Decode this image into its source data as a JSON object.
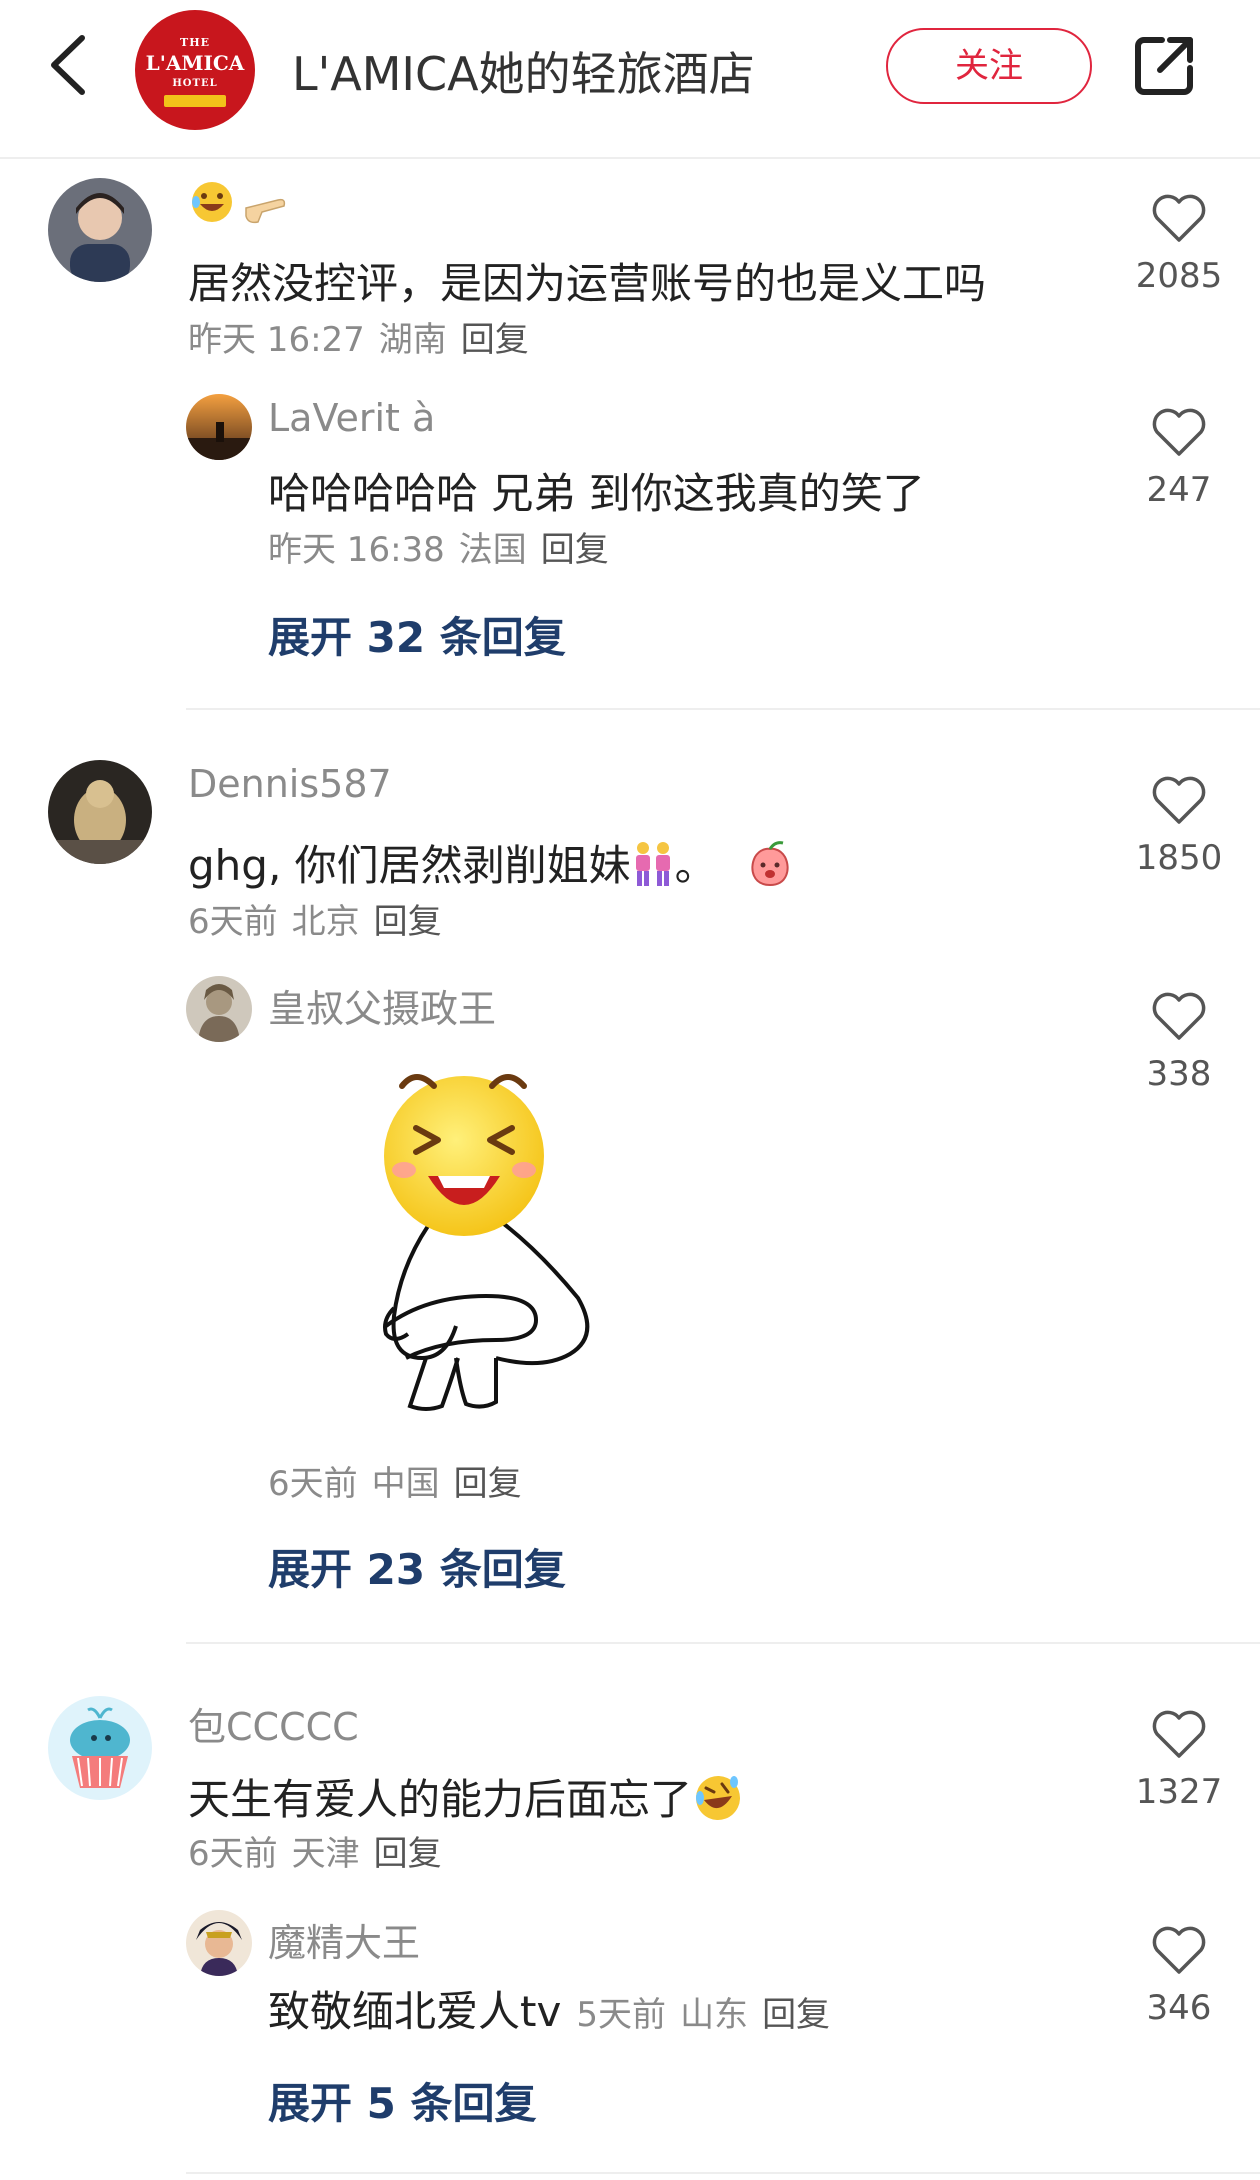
{
  "header": {
    "logo_text": {
      "line1": "THE",
      "line2": "L'AMICA",
      "line3": "HOTEL"
    },
    "title": "L'AMICA她的轻旅酒店",
    "follow_label": "关注"
  },
  "comments": [
    {
      "username": "",
      "text": "居然没控评，是因为运营账号的也是义工吗",
      "time": "昨天 16:27",
      "location": "湖南",
      "reply_label": "回复",
      "likes": "2085",
      "replies": [
        {
          "username": "LaVerit à",
          "text": "哈哈哈哈哈 兄弟 到你这我真的笑了",
          "time": "昨天 16:38",
          "location": "法国",
          "reply_label": "回复",
          "likes": "247"
        }
      ],
      "expand_label": "展开 32 条回复"
    },
    {
      "username": "Dennis587",
      "text": "ghg, 你们居然剥削姐妹",
      "text_suffix": "。",
      "time": "6天前",
      "location": "北京",
      "reply_label": "回复",
      "likes": "1850",
      "replies": [
        {
          "username": "皇叔父摄政王",
          "text": "",
          "time": "6天前",
          "location": "中国",
          "reply_label": "回复",
          "likes": "338"
        }
      ],
      "expand_label": "展开 23 条回复"
    },
    {
      "username": "包CCCCC",
      "text": "天生有爱人的能力后面忘了",
      "time": "6天前",
      "location": "天津",
      "reply_label": "回复",
      "likes": "1327",
      "replies": [
        {
          "username": "魔精大王",
          "text": "致敬缅北爱人tv",
          "time": "5天前",
          "location": "山东",
          "reply_label": "回复",
          "likes": "346"
        }
      ],
      "expand_label": "展开 5 条回复"
    }
  ],
  "colors": {
    "accent": "#e0253e",
    "link": "#1f3d6b",
    "brand": "#c8161d"
  }
}
